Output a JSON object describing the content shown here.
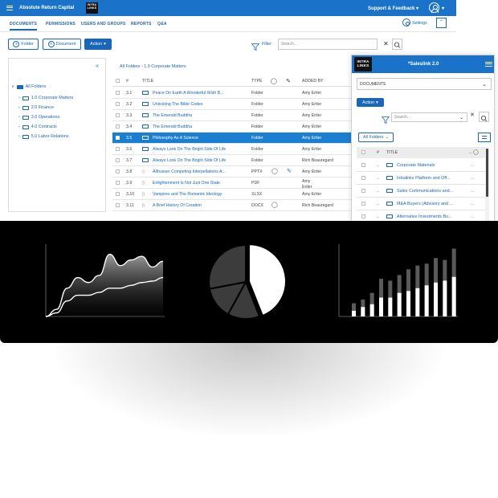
{
  "topbar": {
    "company": "Absolute Return Capital",
    "logo_line1": "INTRA",
    "logo_line2": "LINKS",
    "support": "Support & Feedback"
  },
  "tabs": [
    "DOCUMENTS",
    "PERMISSIONS",
    "USERS AND GROUPS",
    "REPORTS",
    "Q&A"
  ],
  "settings_label": "Settings",
  "toolbar": {
    "folder_btn": "Folder",
    "document_btn": "Document",
    "action_btn": "Action",
    "filter_label": "Filter",
    "search_placeholder": "Search..."
  },
  "tree": {
    "root": "All Folders",
    "items": [
      "1.0 Corporate Matters",
      "2.0 Finance",
      "3.0 Operations",
      "4.0 Contracts",
      "5.0 Labor Relations"
    ]
  },
  "breadcrumb": "All Folders  ›  1.0 Corporate Matters",
  "grid": {
    "headers": {
      "num": "#",
      "title": "TITLE",
      "type": "TYPE",
      "added_by": "ADDED BY"
    },
    "rows": [
      {
        "num": "3.1",
        "title": "Peace On Earth A Wonderful Wish B...",
        "type": "Folder",
        "added_by": "Amy Ertler"
      },
      {
        "num": "3.2",
        "title": "Unlocking The Bible Codes",
        "type": "Folder",
        "added_by": "Amy Ertler"
      },
      {
        "num": "3.3",
        "title": "The Emerald Buddha",
        "type": "Folder",
        "added_by": "Amy Ertler"
      },
      {
        "num": "3.4",
        "title": "The Emerald Buddha",
        "type": "Folder",
        "added_by": "Amy Ertler"
      },
      {
        "num": "3.5",
        "title": "Philosophy As A Science",
        "type": "Folder",
        "added_by": "Amy Ertler"
      },
      {
        "num": "3.6",
        "title": "Always Look On The Bright Side Of Life",
        "type": "Folder",
        "added_by": "Amy Ertler"
      },
      {
        "num": "3.7",
        "title": "Always Look On The Bright Side Of Life",
        "type": "Folder",
        "added_by": "Rich Beauregard"
      },
      {
        "num": "3.8",
        "title": "Althusser Competing Interpellations A...",
        "type": "PPTX",
        "added_by": "Amy Ertler"
      },
      {
        "num": "3.9",
        "title": "Enlightenment Is Not Just One State",
        "type": "PDF",
        "added_by": "Amy Ertler"
      },
      {
        "num": "3.10",
        "title": "Vampires and The Romantic Ideology",
        "type": "XLSX",
        "added_by": "Amy Ertler"
      },
      {
        "num": "3.11",
        "title": "A Brief History Of Creation",
        "type": "DOCX",
        "added_by": "Rich Beauregard"
      }
    ]
  },
  "saleslink": {
    "logo_line1": "INTRA",
    "logo_line2": "LINKS",
    "title": "*Saleslink 2.0",
    "dropdown": "DOCUMENTS",
    "action_btn": "Action",
    "search_placeholder": "Search...",
    "all_folders": "All Folders",
    "headers": {
      "num": "#",
      "title": "TITLE"
    },
    "rows": [
      {
        "num": "..",
        "title": "Corporate Materials",
        "more": ".."
      },
      {
        "num": "..",
        "title": "Intralinks Platform and Off...",
        "more": ".."
      },
      {
        "num": "..",
        "title": "Sales Communications and...",
        "more": ".."
      },
      {
        "num": "..",
        "title": "M&A Buyers (Advisory and ...",
        "more": ".."
      },
      {
        "num": "..",
        "title": "Alternative Investments Bu...",
        "more": ".."
      }
    ]
  },
  "colors": {
    "brand": "#1a73c8",
    "selected_row": "#1a7fd0",
    "banner": "#000000"
  },
  "chart_data": [
    {
      "type": "area",
      "series": [
        {
          "values": [
            0,
            10,
            40,
            55,
            48,
            58,
            88,
            72,
            80,
            85,
            70,
            78
          ]
        },
        {
          "values": [
            0,
            5,
            22,
            30,
            30,
            34,
            40,
            40,
            44,
            48,
            50,
            55
          ]
        }
      ]
    },
    {
      "type": "pie",
      "series": [
        {
          "values": [
            44,
            14,
            14,
            28
          ]
        }
      ]
    },
    {
      "type": "bar",
      "series": [
        {
          "values": [
            6,
            10,
            13,
            20,
            20,
            25,
            27,
            30,
            33,
            36,
            38,
            42
          ]
        },
        {
          "values": [
            14,
            18,
            25,
            40,
            38,
            44,
            50,
            54,
            56,
            62,
            60,
            72
          ]
        }
      ]
    }
  ]
}
